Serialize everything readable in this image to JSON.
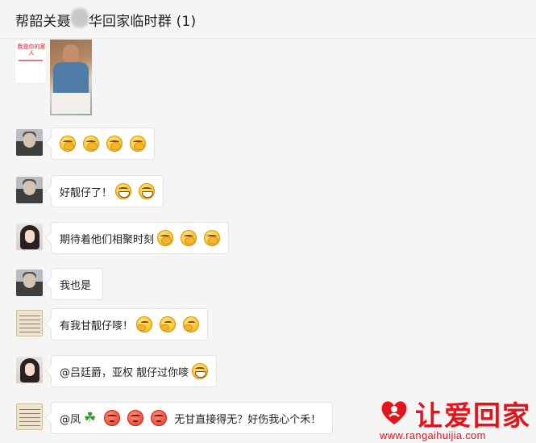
{
  "header": {
    "title_part1": "帮韶关聂",
    "title_part2": "华回家临时群 (1)"
  },
  "colors": {
    "background": "#f5f5f5",
    "bubble": "#ffffff",
    "watermark_red": "#e3141b"
  },
  "shared_media": {
    "poster_text": "我是你的家人",
    "photo_icon": "photo-thumbnail"
  },
  "messages": [
    {
      "avatar": "man-avatar",
      "text": "",
      "emojis": [
        "cover-mouth",
        "cover-mouth",
        "cover-mouth",
        "cover-mouth"
      ]
    },
    {
      "avatar": "man-avatar",
      "text": "好靓仔了！",
      "emojis": [
        "grin",
        "grin"
      ]
    },
    {
      "avatar": "woman-avatar",
      "text": "期待着他们相聚时刻",
      "emojis": [
        "cover-mouth",
        "cover-mouth",
        "cover-mouth"
      ]
    },
    {
      "avatar": "man-avatar",
      "text": "我也是",
      "emojis": []
    },
    {
      "avatar": "scroll-avatar",
      "text": "有我甘靓仔嘜！",
      "emojis": [
        "thinking",
        "thinking",
        "thinking"
      ]
    },
    {
      "avatar": "woman-avatar",
      "text": "@吕廷爵，亚权 靓仔过你嘜",
      "emojis": [
        "grin"
      ]
    },
    {
      "avatar": "scroll-avatar",
      "text_prefix": "@凤",
      "text": "无甘直接得无？好伤我心个禾！",
      "emojis": [
        "clover",
        "angry",
        "angry",
        "angry"
      ]
    }
  ],
  "watermark": {
    "brand": "让爱回家",
    "url": "www.rangaihuijia.com"
  }
}
